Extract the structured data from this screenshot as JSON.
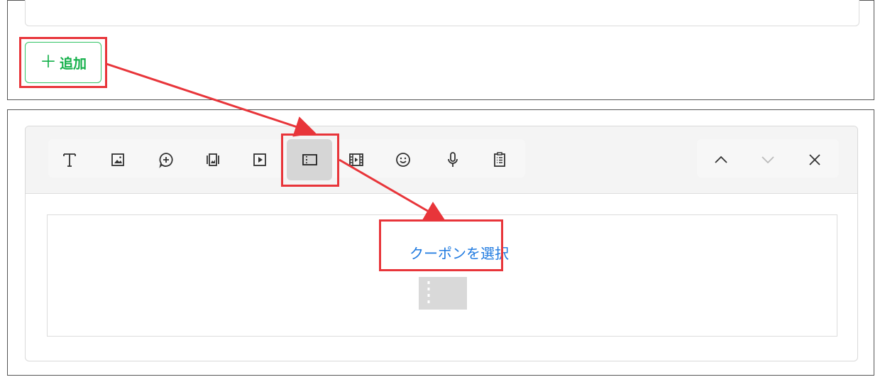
{
  "add_panel": {
    "add_button": {
      "plus": "＋",
      "label": "追加"
    }
  },
  "editor": {
    "toolbar": {
      "tools": [
        {
          "name": "text-tool",
          "icon": "text-icon",
          "selected": false
        },
        {
          "name": "image-tool",
          "icon": "image-icon",
          "selected": false
        },
        {
          "name": "stamp-tool",
          "icon": "chat-plus-icon",
          "selected": false
        },
        {
          "name": "image-carousel-tool",
          "icon": "carousel-icon",
          "selected": false
        },
        {
          "name": "video-tool",
          "icon": "video-icon",
          "selected": false
        },
        {
          "name": "coupon-tool",
          "icon": "coupon-icon",
          "selected": true
        },
        {
          "name": "rich-video-tool",
          "icon": "film-icon",
          "selected": false
        },
        {
          "name": "emoji-tool",
          "icon": "smile-icon",
          "selected": false
        },
        {
          "name": "voice-tool",
          "icon": "microphone-icon",
          "selected": false
        },
        {
          "name": "survey-tool",
          "icon": "clipboard-icon",
          "selected": false
        }
      ],
      "nav": [
        {
          "name": "move-up",
          "icon": "chevron-up-icon",
          "enabled": true
        },
        {
          "name": "move-down",
          "icon": "chevron-down-icon",
          "enabled": false
        },
        {
          "name": "close",
          "icon": "close-icon",
          "enabled": true
        }
      ]
    },
    "content": {
      "coupon_link": "クーポンを選択",
      "placeholder_icon": "coupon-placeholder-icon"
    }
  },
  "colors": {
    "highlight": "#e8353a",
    "accent_green": "#14b04a",
    "link_blue": "#1f7ae0",
    "icon_dark": "#333333",
    "icon_disabled": "#bbbbbb"
  }
}
